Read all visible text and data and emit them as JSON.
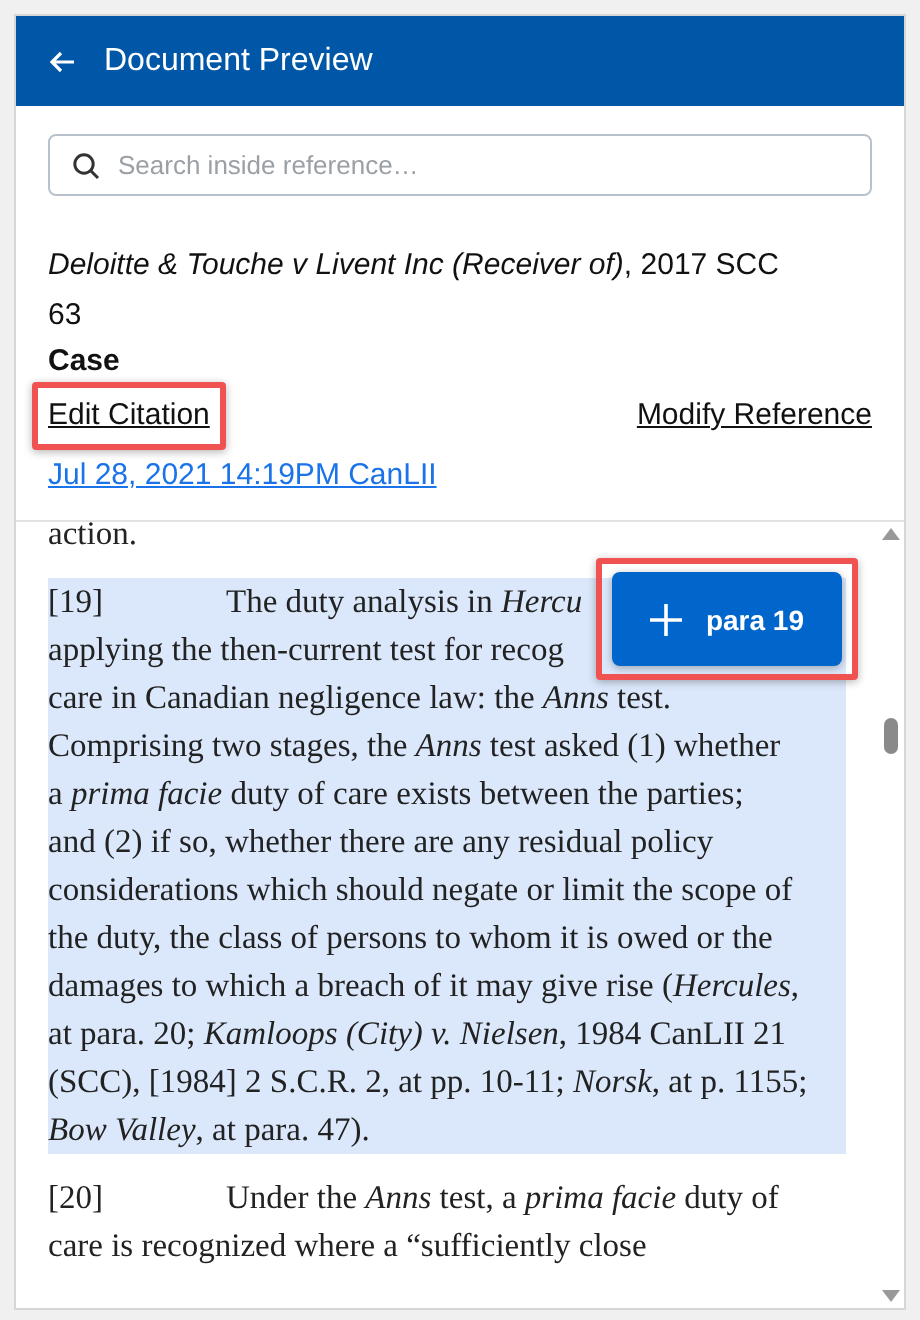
{
  "header": {
    "title": "Document Preview"
  },
  "search": {
    "placeholder": "Search inside reference…"
  },
  "citation": "*Deloitte & Touche v Livent Inc (Receiver of)*, 2017 SCC 63",
  "type": "Case",
  "links": [
    {
      "label": "Edit Citation",
      "highlighted": true
    },
    {
      "label": "Modify Reference",
      "highlighted": false
    }
  ],
  "date_link": "Jul 28, 2021 14:19PM CanLII",
  "document": {
    "paragraphs": [
      {
        "lines": [
          "action."
        ],
        "selected": false
      },
      {
        "number": "[19]",
        "lines": [
          "The duty analysis in *Hercu*",
          "applying the then-current test for recog",
          "care in Canadian negligence law: the *Anns* test.",
          "Comprising two stages, the *Anns* test asked (1) whether",
          "a *prima facie* duty of care exists between the parties;",
          "and (2) if so, whether there are any residual policy",
          "considerations which should negate or limit the scope of",
          "the duty, the class of persons to whom it is owed or the",
          "damages to which a breach of it may give rise (*Hercules*,",
          "at para. 20; *Kamloops (City) v. Nielsen*, 1984 CanLII 21",
          "(SCC), [1984] 2 S.C.R. 2, at pp. 10-11; *Norsk*, at p. 1155;",
          "*Bow Valley*, at para. 47)."
        ],
        "selected": true
      },
      {
        "number": "[20]",
        "lines": [
          "Under the *Anns* test, a *prima facie* duty of",
          "care is recognized where a “sufficiently close"
        ],
        "selected": false
      }
    ]
  },
  "add_button": {
    "label": "para 19",
    "highlighted": true
  }
}
